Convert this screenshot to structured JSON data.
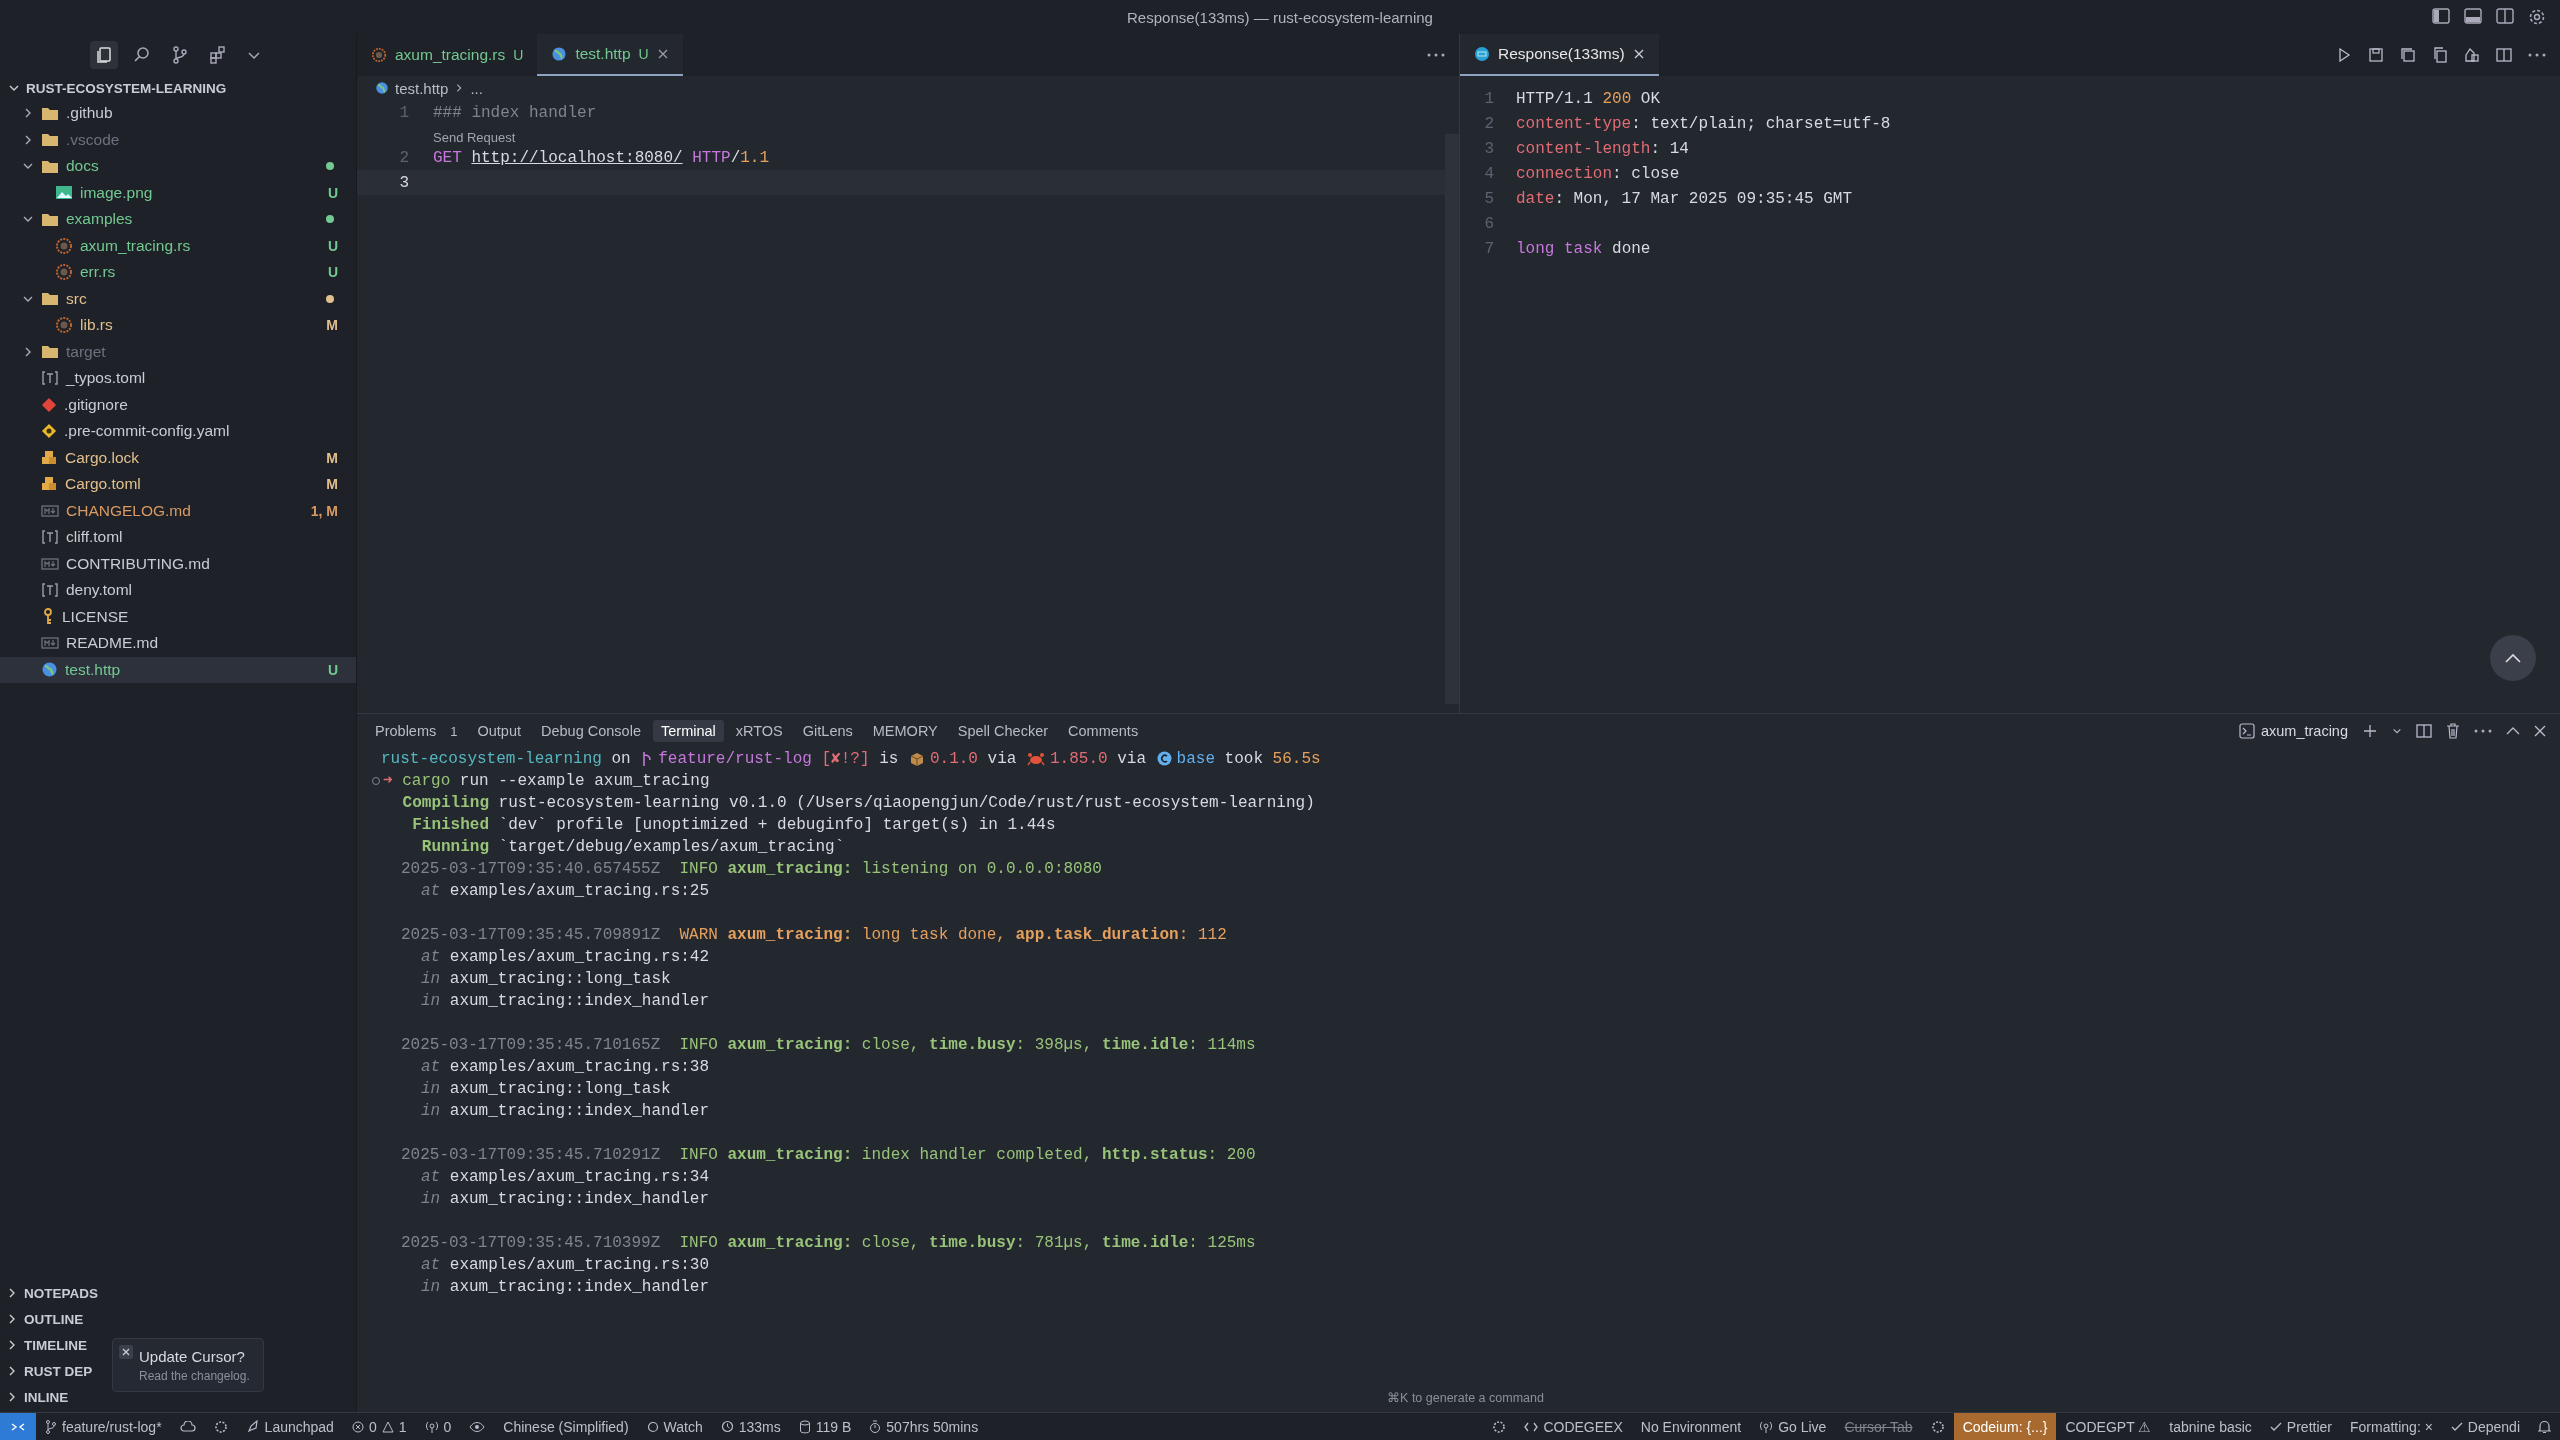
{
  "window": {
    "title": "Response(133ms) — rust-ecosystem-learning"
  },
  "explorer": {
    "title": "RUST-ECOSYSTEM-LEARNING",
    "tree": [
      {
        "name": ".github",
        "kind": "folder",
        "color": "#c9ccd3",
        "expanded": false,
        "selected": false
      },
      {
        "name": ".vscode",
        "kind": "folder",
        "color": "#6b717d",
        "expanded": false,
        "selected": false
      },
      {
        "name": "docs",
        "kind": "folder",
        "color": "#73c991",
        "dot": true,
        "expanded": true,
        "selected": false,
        "children": [
          {
            "name": "image.png",
            "kind": "image",
            "color": "#73c991",
            "badge": "U",
            "selected": false
          }
        ]
      },
      {
        "name": "examples",
        "kind": "folder",
        "color": "#73c991",
        "dot": true,
        "expanded": true,
        "selected": false,
        "children": [
          {
            "name": "axum_tracing.rs",
            "kind": "rust",
            "color": "#73c991",
            "badge": "U",
            "selected": false
          },
          {
            "name": "err.rs",
            "kind": "rust",
            "color": "#73c991",
            "badge": "U",
            "selected": false
          }
        ]
      },
      {
        "name": "src",
        "kind": "folder",
        "color": "#e2c08d",
        "dot": true,
        "expanded": true,
        "selected": false,
        "children": [
          {
            "name": "lib.rs",
            "kind": "rust",
            "color": "#e2c08d",
            "badge": "M",
            "selected": false
          }
        ]
      },
      {
        "name": "target",
        "kind": "folder",
        "color": "#6b717d",
        "expanded": false,
        "selected": false
      },
      {
        "name": "_typos.toml",
        "kind": "toml",
        "color": "#c9ccd3",
        "selected": false
      },
      {
        "name": ".gitignore",
        "kind": "git",
        "color": "#c9ccd3",
        "selected": false
      },
      {
        "name": ".pre-commit-config.yaml",
        "kind": "yaml",
        "color": "#c9ccd3",
        "selected": false
      },
      {
        "name": "Cargo.lock",
        "kind": "cargo",
        "color": "#e2c08d",
        "badge": "M",
        "selected": false
      },
      {
        "name": "Cargo.toml",
        "kind": "cargo",
        "color": "#e2c08d",
        "badge": "M",
        "selected": false
      },
      {
        "name": "CHANGELOG.md",
        "kind": "markdown",
        "color": "#d99a63",
        "badge": "1, M",
        "selected": false
      },
      {
        "name": "cliff.toml",
        "kind": "toml",
        "color": "#c9ccd3",
        "selected": false
      },
      {
        "name": "CONTRIBUTING.md",
        "kind": "markdown",
        "color": "#c9ccd3",
        "selected": false
      },
      {
        "name": "deny.toml",
        "kind": "toml",
        "color": "#c9ccd3",
        "selected": false
      },
      {
        "name": "LICENSE",
        "kind": "license",
        "color": "#c9ccd3",
        "selected": false
      },
      {
        "name": "README.md",
        "kind": "markdown",
        "color": "#c9ccd3",
        "selected": false
      },
      {
        "name": "test.http",
        "kind": "http",
        "color": "#73c991",
        "badge": "U",
        "selected": true
      }
    ],
    "sections": [
      "NOTEPADS",
      "OUTLINE",
      "TIMELINE",
      "RUST DEP",
      "INLINE"
    ]
  },
  "editor": {
    "tabs": [
      {
        "label": "axum_tracing.rs",
        "kind": "rust",
        "badge": "U",
        "selected": false
      },
      {
        "label": "test.http",
        "kind": "http",
        "badge": "U",
        "selected": true
      }
    ],
    "breadcrumb": [
      "test.http",
      "..."
    ],
    "lines": [
      {
        "number": "1",
        "current": false,
        "tokens": [
          {
            "kind": "comment",
            "text": "### index handler"
          }
        ]
      },
      {
        "number": "2",
        "current": false,
        "lens": "Send Request",
        "tokens": [
          {
            "kind": "keyword",
            "text": "GET "
          },
          {
            "kind": "url",
            "text": "http://localhost:8080/"
          },
          {
            "kind": "keyword",
            "text": " HTTP"
          },
          {
            "kind": "plain",
            "text": "/"
          },
          {
            "kind": "number",
            "text": "1.1"
          }
        ]
      },
      {
        "number": "3",
        "current": true
      }
    ]
  },
  "response": {
    "tab": {
      "label": "Response(133ms)",
      "selected": true
    },
    "lines": [
      {
        "number": "1",
        "tokens": [
          {
            "kind": "plain",
            "text": "HTTP/1.1 "
          },
          {
            "kind": "number",
            "text": "200"
          },
          {
            "kind": "plain",
            "text": " OK"
          }
        ]
      },
      {
        "number": "2",
        "tokens": [
          {
            "kind": "header",
            "text": "content-type"
          },
          {
            "kind": "plain",
            "text": ": text/plain; charset=utf-8"
          }
        ]
      },
      {
        "number": "3",
        "tokens": [
          {
            "kind": "header",
            "text": "content-length"
          },
          {
            "kind": "plain",
            "text": ": 14"
          }
        ]
      },
      {
        "number": "4",
        "tokens": [
          {
            "kind": "header",
            "text": "connection"
          },
          {
            "kind": "plain",
            "text": ": close"
          }
        ]
      },
      {
        "number": "5",
        "tokens": [
          {
            "kind": "header",
            "text": "date"
          },
          {
            "kind": "plain",
            "text": ": Mon, 17 Mar 2025 09:35:45 GMT"
          }
        ]
      },
      {
        "number": "6"
      },
      {
        "number": "7",
        "tokens": [
          {
            "kind": "keyword",
            "text": "long task"
          },
          {
            "kind": "plain",
            "text": " done"
          }
        ]
      }
    ]
  },
  "panel": {
    "tabs": [
      {
        "label": "Problems",
        "count": "1",
        "selected": false
      },
      {
        "label": "Output",
        "selected": false
      },
      {
        "label": "Debug Console",
        "selected": false
      },
      {
        "label": "Terminal",
        "selected": true
      },
      {
        "label": "xRTOS",
        "selected": false
      },
      {
        "label": "GitLens",
        "selected": false
      },
      {
        "label": "MEMORY",
        "selected": false
      },
      {
        "label": "Spell Checker",
        "selected": false
      },
      {
        "label": "Comments",
        "selected": false
      }
    ],
    "terminal_name": "axum_tracing",
    "prompt": [
      {
        "kind": "cyan",
        "text": "rust-ecosystem-learning"
      },
      {
        "kind": "plain",
        "text": " on "
      },
      {
        "kind": "branch"
      },
      {
        "kind": "magenta",
        "text": "feature/rust-log "
      },
      {
        "kind": "red",
        "text": "[✘!?]"
      },
      {
        "kind": "plain",
        "text": " is "
      },
      {
        "kind": "package"
      },
      {
        "kind": "red",
        "text": "0.1.0"
      },
      {
        "kind": "plain",
        "text": " via "
      },
      {
        "kind": "crab"
      },
      {
        "kind": "red",
        "text": "1.85.0"
      },
      {
        "kind": "plain",
        "text": " via "
      },
      {
        "kind": "conda"
      },
      {
        "kind": "blue",
        "text": "base"
      },
      {
        "kind": "plain",
        "text": " took "
      },
      {
        "kind": "orange",
        "text": "56.5s"
      }
    ],
    "command": {
      "arrow": "➜",
      "program": "cargo",
      "args": "run --example axum_tracing"
    },
    "cargo": [
      {
        "label": "Compiling",
        "text": "rust-ecosystem-learning v0.1.0 (/Users/qiaopengjun/Code/rust/rust-ecosystem-learning)"
      },
      {
        "label": "Finished",
        "text": "`dev` profile [unoptimized + debuginfo] target(s) in 1.44s"
      },
      {
        "label": "Running",
        "text": "`target/debug/examples/axum_tracing`"
      }
    ],
    "logs": [
      {
        "time": "2025-03-17T09:35:40.657455Z",
        "level": "INFO",
        "target": "axum_tracing:",
        "message": "listening on 0.0.0.0:8080",
        "at": {
          "word": "at",
          "path": "examples/axum_tracing.rs:25"
        }
      },
      {
        "time": "2025-03-17T09:35:45.709891Z",
        "level": "WARN",
        "target": "axum_tracing:",
        "message": "long task done, **app.task_duration**: 112",
        "at": {
          "word": "at",
          "path": "examples/axum_tracing.rs:42"
        },
        "spans": [
          {
            "word": "in",
            "name": "axum_tracing::long_task"
          },
          {
            "word": "in",
            "name": "axum_tracing::index_handler"
          }
        ]
      },
      {
        "time": "2025-03-17T09:35:45.710165Z",
        "level": "INFO",
        "target": "axum_tracing:",
        "message": "close, **time.busy**: 398µs, **time.idle**: 114ms",
        "at": {
          "word": "at",
          "path": "examples/axum_tracing.rs:38"
        },
        "spans": [
          {
            "word": "in",
            "name": "axum_tracing::long_task"
          },
          {
            "word": "in",
            "name": "axum_tracing::index_handler"
          }
        ]
      },
      {
        "time": "2025-03-17T09:35:45.710291Z",
        "level": "INFO",
        "target": "axum_tracing:",
        "message": "index handler completed, **http.status**: 200",
        "at": {
          "word": "at",
          "path": "examples/axum_tracing.rs:34"
        },
        "spans": [
          {
            "word": "in",
            "name": "axum_tracing::index_handler"
          }
        ]
      },
      {
        "time": "2025-03-17T09:35:45.710399Z",
        "level": "INFO",
        "target": "axum_tracing:",
        "message": "close, **time.busy**: 781µs, **time.idle**: 125ms",
        "at": {
          "word": "at",
          "path": "examples/axum_tracing.rs:30"
        },
        "spans": [
          {
            "word": "in",
            "name": "axum_tracing::index_handler"
          }
        ]
      }
    ],
    "hint": "⌘K to generate a command"
  },
  "notification": {
    "title": "Update Cursor?",
    "link": "Read the changelog."
  },
  "status_bar": {
    "left": [
      {
        "kind": "branch",
        "text": "feature/rust-log*"
      },
      {
        "kind": "sync"
      },
      {
        "kind": "tool"
      },
      {
        "kind": "rocket",
        "text": "Launchpad"
      },
      {
        "kind": "problems",
        "errors": "0",
        "warnings": "1"
      },
      {
        "kind": "broadcast",
        "text": "0"
      },
      {
        "kind": "eye"
      },
      {
        "kind": "plain",
        "text": "Chinese (Simplified)"
      },
      {
        "kind": "circle",
        "text": "Watch"
      },
      {
        "kind": "clock",
        "text": "133ms"
      },
      {
        "kind": "db",
        "text": "119 B"
      },
      {
        "kind": "timer",
        "text": "507hrs 50mins"
      }
    ],
    "right": [
      {
        "kind": "tool"
      },
      {
        "kind": "code",
        "text": "CODEGEEX"
      },
      {
        "kind": "plain",
        "text": "No Environment"
      },
      {
        "kind": "broadcast",
        "text": "Go Live"
      },
      {
        "kind": "struck",
        "text": "Cursor Tab"
      },
      {
        "kind": "tool"
      },
      {
        "kind": "highlight",
        "text": "Codeium: {...}"
      },
      {
        "kind": "plain",
        "text": "CODEGPT ⚠"
      },
      {
        "kind": "plain",
        "text": "tabnine basic"
      },
      {
        "kind": "check",
        "text": "Prettier"
      },
      {
        "kind": "plain",
        "text": "Formatting: ×"
      },
      {
        "kind": "check",
        "text": "Dependi"
      },
      {
        "kind": "bell"
      }
    ]
  }
}
